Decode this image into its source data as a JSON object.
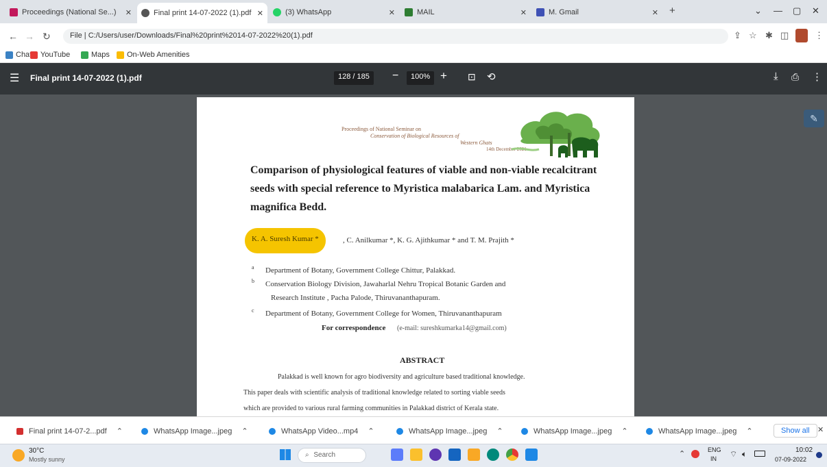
{
  "browser": {
    "tabs": [
      {
        "label": "Proceedings (National Se...)",
        "color": "#c2185b"
      },
      {
        "label": "Final print 14-07-2022 (1).pdf",
        "color": "#555555"
      },
      {
        "label": "(3) WhatsApp",
        "color": "#25d366"
      },
      {
        "label": "MAIL",
        "color": "#2e7d32"
      },
      {
        "label": "M. Gmail",
        "color": "#3f51b5"
      }
    ],
    "new_tab": "+",
    "url": "File | C:/Users/user/Downloads/Final%20print%2014-07-2022%20(1).pdf",
    "bookmarks": [
      {
        "label": "Chat",
        "color": "#3b82c4"
      },
      {
        "label": "YouTube",
        "color": "#e53935"
      },
      {
        "label": "Maps",
        "color": "#34a853"
      },
      {
        "label": "On-Web Amenities",
        "color": "#fbbc05"
      }
    ]
  },
  "pdf": {
    "file_name": "Final print 14-07-2022 (1).pdf",
    "page_box": "128 / 185",
    "zoom": "100%",
    "header": {
      "line1": "Proceedings of National Seminar on",
      "line2": "Conservation of Biological Resources of",
      "line3": "Western Ghats",
      "line4": "14th December 2021"
    },
    "title_lines": [
      "Comparison of physiological features of viable and non-viable recalcitrant",
      "seeds with special reference to Myristica malabarica Lam. and Myristica",
      "magnifica Bedd."
    ],
    "authors_highlight": "K. A. Suresh Kumar *",
    "authors_rest": ", C. Anilkumar *, K. G. Ajithkumar * and  T. M. Prajith *",
    "affiliations": [
      "Department of Botany, Government College Chittur, Palakkad.",
      "Conservation Biology Division, Jawaharlal Nehru Tropical Botanic Garden and",
      "Research Institute , Pacha Palode, Thiruvananthapuram.",
      "Department of Botany, Government College for Women, Thiruvananthapuram"
    ],
    "correspondence_label": "For correspondence",
    "correspondence_email": "(e-mail: sureshkumarka14@gmail.com)",
    "abstract_heading": "ABSTRACT",
    "abstract_lines": [
      "Palakkad is well known for agro biodiversity and agriculture based traditional knowledge.",
      "This paper deals with scientific analysis of traditional knowledge related to sorting viable seeds",
      "which are provided to various rural farming communities in Palakkad district of Kerala state."
    ]
  },
  "downloads": {
    "items": [
      {
        "label": "Final print 14-07-2...pdf",
        "color": "#d32f2f"
      },
      {
        "label": "WhatsApp Image...jpeg",
        "color": "#1e88e5"
      },
      {
        "label": "WhatsApp Video...mp4",
        "color": "#1e88e5"
      },
      {
        "label": "WhatsApp Image...jpeg",
        "color": "#1e88e5"
      },
      {
        "label": "WhatsApp Image...jpeg",
        "color": "#1e88e5"
      },
      {
        "label": "WhatsApp Image...jpeg",
        "color": "#1e88e5"
      }
    ],
    "show_all": "Show all"
  },
  "taskbar": {
    "weather_temp": "30°C",
    "weather_desc": "Mostly sunny",
    "search_label": "Search",
    "lang_top": "ENG",
    "lang_bottom": "IN",
    "time": "10:02",
    "date": "07-09-2022"
  },
  "colors": {
    "highlight": "#f5c400",
    "pdf_toolbar": "#323639",
    "viewer_bg": "#525659"
  }
}
